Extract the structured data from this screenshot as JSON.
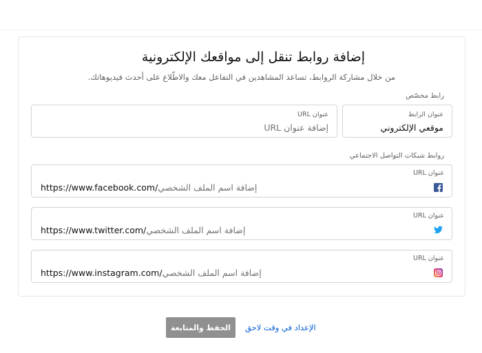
{
  "header": {},
  "card": {
    "title": "إضافة روابط تنقل إلى مواقعك الإلكترونية",
    "subtitle": "من خلال مشاركة الروابط، تساعد المشاهدين في التفاعل معك والاطّلاع على أحدث فيديوهاتك."
  },
  "custom_link": {
    "section_label": "رابط مخصّص",
    "title_field": {
      "label": "عنوان الرابط",
      "value": "موقعي الإلكتروني"
    },
    "url_field": {
      "label": "عنوان URL",
      "placeholder": "إضافة عنوان URL"
    }
  },
  "social": {
    "section_label": "روابط شبكات التواصل الاجتماعي",
    "items": [
      {
        "label": "عنوان URL",
        "prefix": "https://www.facebook.com/",
        "placeholder": "إضافة اسم الملف الشخصي",
        "icon": "facebook-icon",
        "color": "#3b5998"
      },
      {
        "label": "عنوان URL",
        "prefix": "https://www.twitter.com/",
        "placeholder": "إضافة اسم الملف الشخصي",
        "icon": "twitter-icon",
        "color": "#1da1f2"
      },
      {
        "label": "عنوان URL",
        "prefix": "https://www.instagram.com/",
        "placeholder": "إضافة اسم الملف الشخصي",
        "icon": "instagram-icon",
        "color": "#e1306c"
      }
    ]
  },
  "footer": {
    "save_label": "الحفظ والمتابعة",
    "later_label": "الإعداد في وقت لاحق"
  },
  "colors": {
    "link": "#065fd4",
    "button_disabled": "#909090",
    "border": "#d3d3d3"
  }
}
